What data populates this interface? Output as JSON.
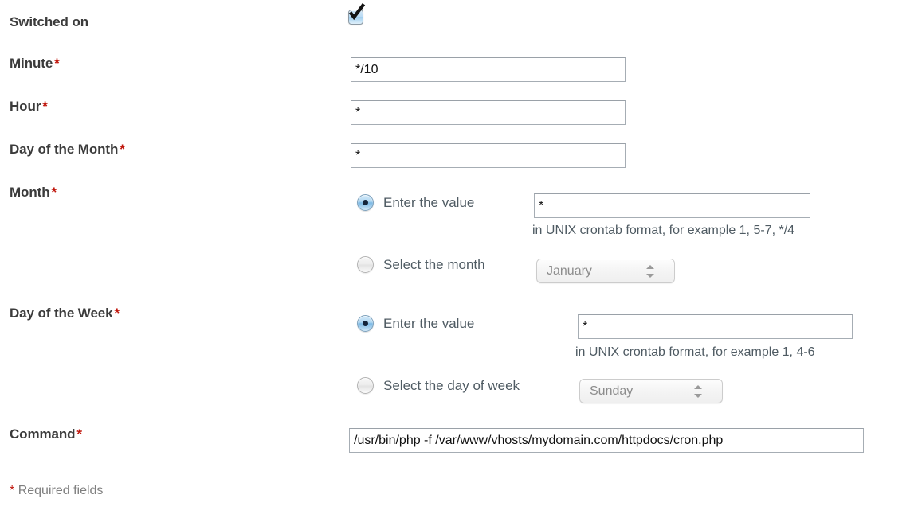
{
  "form": {
    "required_marker": "*",
    "footer_note": "Required fields",
    "rows": {
      "switched_on": {
        "label": "Switched on",
        "checked": true
      },
      "minute": {
        "label": "Minute",
        "required": "*",
        "value": "*/10"
      },
      "hour": {
        "label": "Hour",
        "required": "*",
        "value": "*"
      },
      "day_of_month": {
        "label": "Day of the Month",
        "required": "*",
        "value": "*"
      },
      "month": {
        "label": "Month",
        "required": "*",
        "enter_value_label": "Enter the value",
        "value": "*",
        "help_text": "in UNIX crontab format, for example 1, 5-7, */4",
        "select_label": "Select the month",
        "select_value": "January",
        "selected_mode": "enter_value"
      },
      "day_of_week": {
        "label": "Day of the Week",
        "required": "*",
        "enter_value_label": "Enter the value",
        "value": "*",
        "help_text": "in UNIX crontab format, for example 1, 4-6",
        "select_label": "Select the day of week",
        "select_value": "Sunday",
        "selected_mode": "enter_value"
      },
      "command": {
        "label": "Command",
        "required": "*",
        "value": "/usr/bin/php -f /var/www/vhosts/mydomain.com/httpdocs/cron.php"
      }
    }
  },
  "colors": {
    "label": "#3b3b3b",
    "required_star": "#c0160c",
    "body_text": "#4f5b63",
    "muted": "#8c8c8c",
    "input_border": "#a6adb4",
    "radio_accent": "#7cb9e4"
  }
}
